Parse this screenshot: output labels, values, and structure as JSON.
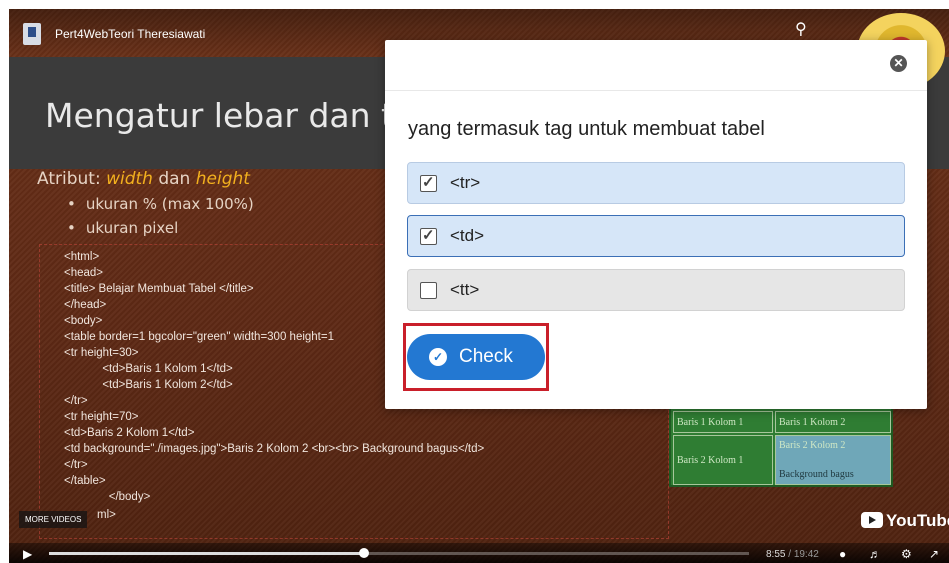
{
  "player": {
    "video_title": "Pert4WebTeori Theresiawati",
    "more_videos_label": "MORE VIDEOS",
    "youtube_label": "YouTube",
    "time_current": "8:55",
    "time_separator": " / ",
    "time_total": "19:42",
    "progress_fraction": 0.45
  },
  "slide": {
    "title": "Mengatur lebar dan ti",
    "attr_prefix": "Atribut: ",
    "attr_width": "width",
    "attr_and": " dan ",
    "attr_height": "height",
    "bullets": [
      "ukuran % (max 100%)",
      "ukuran pixel"
    ],
    "code_lines": [
      "<html>",
      "<head>",
      "<title> Belajar Membuat Tabel </title>",
      "</head>",
      "<body>",
      "<table border=1 bgcolor=\"green\" width=300 height=1",
      "<tr height=30>",
      "            <td>Baris 1 Kolom 1</td>",
      "            <td>Baris 1 Kolom 2</td>",
      "</tr>",
      "<tr height=70>",
      "<td>Baris 2 Kolom 1</td>",
      "<td background=\"./images.jpg\">Baris 2 Kolom 2 <br><br> Background bagus</td>",
      "</tr>",
      "</table>",
      "              </body>",
      "ml>"
    ],
    "mini_table": {
      "r1c1": "Baris 1 Kolom 1",
      "r1c2": "Baris 1 Kolom 2",
      "r2c1": "Baris 2 Kolom 1",
      "r2c2": "Baris 2 Kolom 2",
      "r2c2_extra": "Background bagus"
    }
  },
  "quiz": {
    "question": "yang termasuk tag untuk membuat tabel",
    "options": [
      {
        "label": "<tr>",
        "checked": true
      },
      {
        "label": "<td>",
        "checked": true
      },
      {
        "label": "<tt>",
        "checked": false
      }
    ],
    "check_label": "Check",
    "close_icon": "close-icon",
    "check_icon": "checkmark-circle-icon"
  }
}
